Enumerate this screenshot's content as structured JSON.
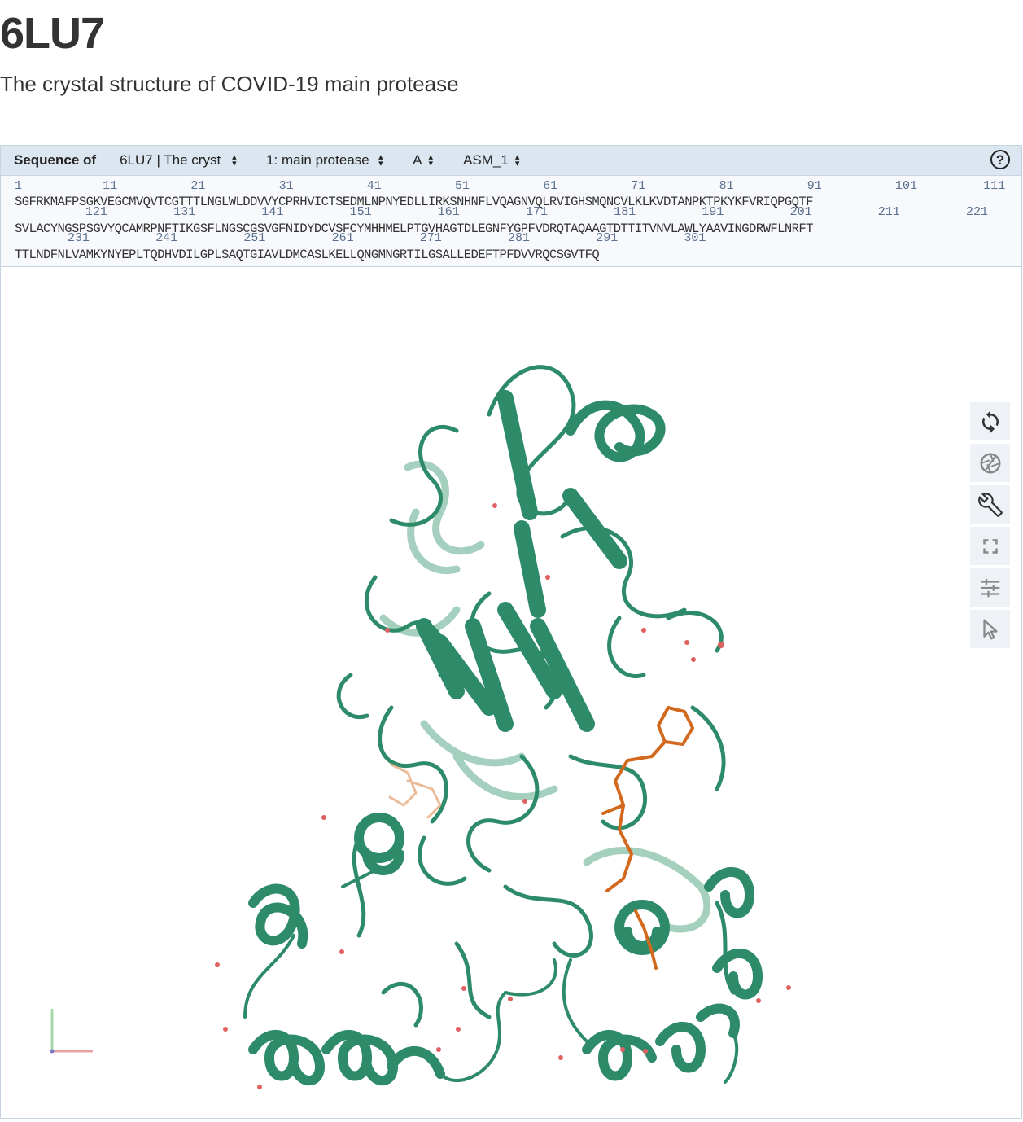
{
  "page": {
    "title": "6LU7",
    "subtitle": "The crystal structure of COVID-19 main protease"
  },
  "sequence_header": {
    "label": "Sequence of",
    "selectors": {
      "entry": "6LU7 | The cryst",
      "entity": "1: main protease",
      "chain": "A",
      "assembly": "ASM_1"
    },
    "help_label": "?"
  },
  "sequence": {
    "lines": [
      "SGFRKMAFPSGKVEGCMVQVTCGTTTLNGLWLDDVVYCPRHVICTSEDMLNPNYEDLLIRKSNHNFLVQAGNVQLRVIGHSMQNCVLKLKVDTANPKTPKYKFVRIQPGQTF",
      "SVLACYNGSPSGVYQCAMRPNFTIKGSFLNGSCGSVGFNIDYDCVSFCYMHHMELPTGVHAGTDLEGNFYGPFVDRQTAQAAGTDTTITVNVLAWLYAAVINGDRWFLNRFT",
      "TTLNDFNLVAMKYNYEPLTQDHVDILGPLSAQTGIAVLDMCASLKELLQNGMNGRTILGSALLEDEFTPFDVVRQCSGVTFQ"
    ],
    "numbers_row1": [
      "1",
      "11",
      "21",
      "31",
      "41",
      "51",
      "61",
      "71",
      "81",
      "91",
      "101",
      "111"
    ],
    "numbers_row2": [
      "121",
      "131",
      "141",
      "151",
      "161",
      "171",
      "181",
      "191",
      "201",
      "211",
      "221"
    ],
    "numbers_row3": [
      "231",
      "241",
      "251",
      "261",
      "271",
      "281",
      "291",
      "301"
    ]
  },
  "toolbar": {
    "items": [
      {
        "name": "spin-toggle",
        "icon": "sync-icon"
      },
      {
        "name": "screenshot",
        "icon": "camera-shutter-icon"
      },
      {
        "name": "controls",
        "icon": "wrench-icon"
      },
      {
        "name": "fullscreen",
        "icon": "expand-icon"
      },
      {
        "name": "settings",
        "icon": "sliders-icon"
      },
      {
        "name": "selection-mode",
        "icon": "cursor-icon"
      }
    ]
  },
  "colors": {
    "cartoon": "#2e8b6a",
    "cartoon_faded": "#8fc4ae",
    "ligand": "#d2691e",
    "water": "#e06060",
    "header_bg": "#dce6f0",
    "axis_x": "#e8a0a0",
    "axis_y": "#a8d8a8"
  }
}
